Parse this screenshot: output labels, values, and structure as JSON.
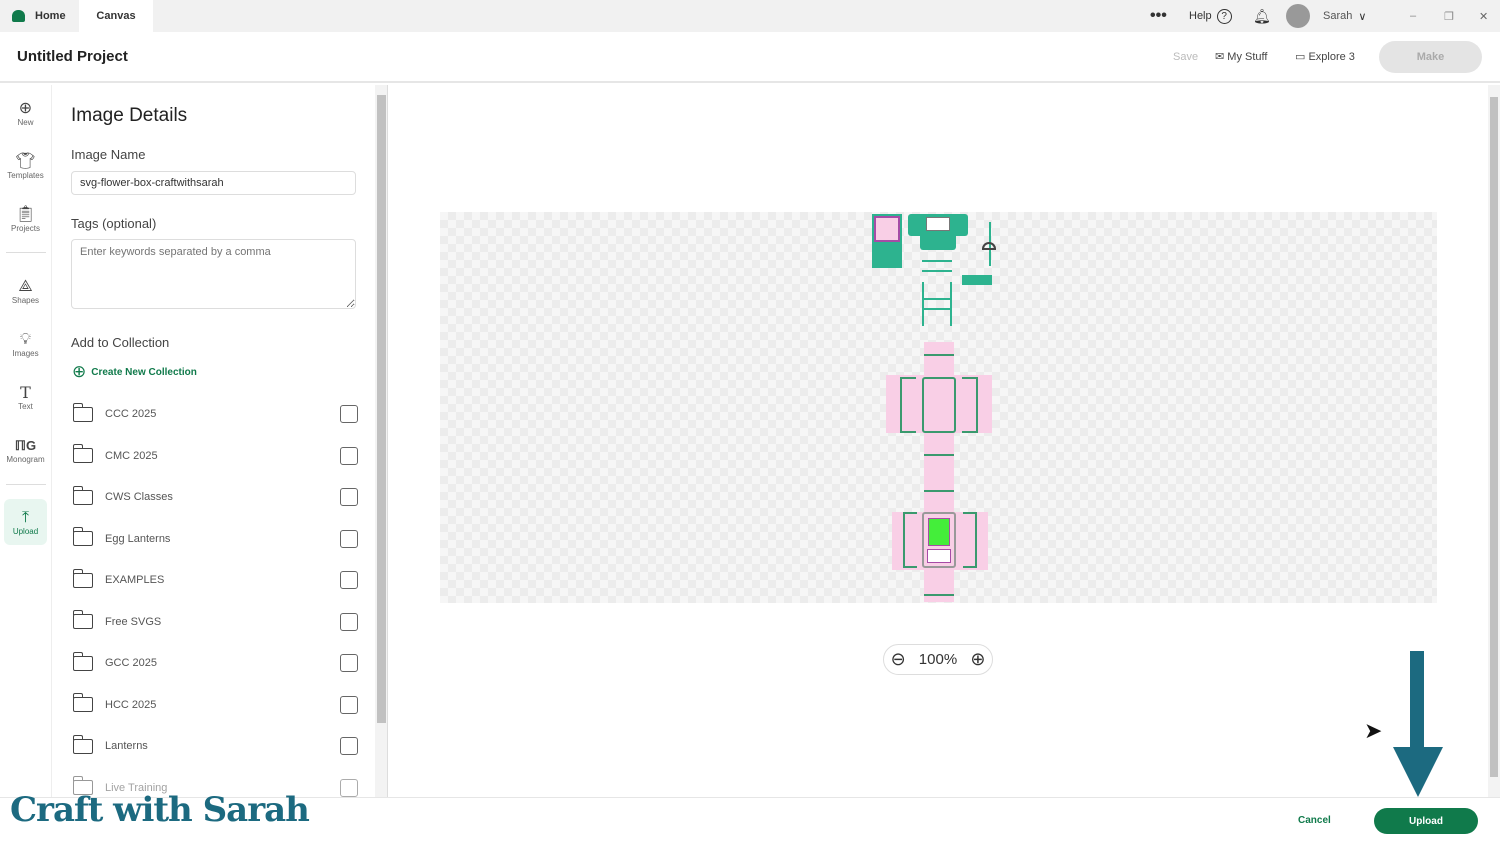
{
  "tabs": [
    "Home",
    "Canvas"
  ],
  "topbar": {
    "help": "Help",
    "user": "Sarah"
  },
  "header": {
    "title": "Untitled Project",
    "save": "Save",
    "my_stuff": "My Stuff",
    "explore": "Explore 3",
    "make": "Make"
  },
  "rail": [
    {
      "label": "New",
      "icon": "plus-circle-icon"
    },
    {
      "label": "Templates",
      "icon": "shirt-icon"
    },
    {
      "label": "Projects",
      "icon": "clipboard-icon"
    },
    {
      "label": "Shapes",
      "icon": "shapes-icon"
    },
    {
      "label": "Images",
      "icon": "bulb-icon"
    },
    {
      "label": "Text",
      "icon": "text-icon"
    },
    {
      "label": "Monogram",
      "icon": "monogram-icon"
    },
    {
      "label": "Upload",
      "icon": "upload-icon"
    }
  ],
  "panel": {
    "title": "Image Details",
    "name_label": "Image Name",
    "name_value": "svg-flower-box-craftwithsarah",
    "tags_label": "Tags (optional)",
    "tags_placeholder": "Enter keywords separated by a comma",
    "collection_label": "Add to Collection",
    "create_new": "Create New Collection",
    "collections": [
      "CCC 2025",
      "CMC 2025",
      "CWS Classes",
      "Egg Lanterns",
      "EXAMPLES",
      "Free SVGS",
      "GCC 2025",
      "HCC 2025",
      "Lanterns",
      "Live Training"
    ]
  },
  "zoom": {
    "value": "100%"
  },
  "footer": {
    "cancel": "Cancel",
    "upload": "Upload"
  },
  "watermark": "Craft with Sarah",
  "colors": {
    "brand": "#107a4b",
    "teal": "#2db38f",
    "pink": "#f9cfe6",
    "arrow": "#1c6a80"
  }
}
